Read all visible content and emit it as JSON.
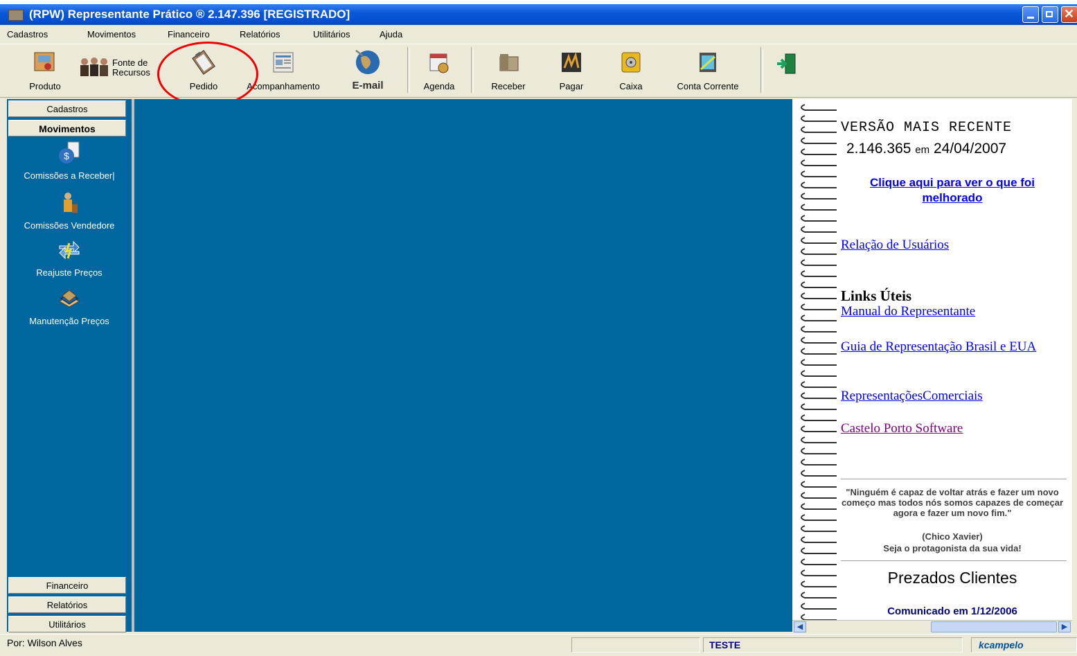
{
  "window": {
    "title": "(RPW) Representante Prático ® 2.147.396 [REGISTRADO]"
  },
  "menu": [
    "Cadastros",
    "Movimentos",
    "Financeiro",
    "Relatórios",
    "Utilitários",
    "Ajuda"
  ],
  "toolbar": {
    "produto": "Produto",
    "fonte_1": "Fonte de",
    "fonte_2": "Recursos",
    "pedido": "Pedido",
    "acompanhamento": "Acompanhamento",
    "email": "E-mail",
    "agenda": "Agenda",
    "receber": "Receber",
    "pagar": "Pagar",
    "caixa": "Caixa",
    "conta_corrente": "Conta Corrente"
  },
  "sidebar": {
    "cadastros": "Cadastros",
    "movimentos": "Movimentos",
    "items": [
      "Comissões a Receber|",
      "Comissões Vendedore",
      "Reajuste Preços",
      "Manutenção Preços"
    ],
    "financeiro": "Financeiro",
    "relatorios": "Relatórios",
    "utilitarios": "Utilitários"
  },
  "panel": {
    "versao_title": "VERSÃO MAIS RECENTE",
    "versao_num": "2.146.365",
    "versao_em": "em",
    "versao_date": "24/04/2007",
    "clique": "Clique aqui para ver o que foi melhorado",
    "relacao": "Relação de Usuários",
    "links_title": "Links Úteis",
    "manual": "Manual do Representante",
    "guia": "Guia de Representação Brasil e EUA",
    "representacoes": "RepresentaçõesComerciais",
    "castelo": "Castelo Porto Software",
    "quote": "\"Ninguém é capaz de voltar atrás e fazer um novo começo mas todos nós somos capazes de começar agora e fazer um novo fim.\"",
    "author": "(Chico Xavier)",
    "protagonista": "Seja o protagonista da sua vida!",
    "prezados": "Prezados Clientes",
    "comunicado": "Comunicado em 1/12/2006"
  },
  "status": {
    "por": "Por: Wilson Alves",
    "teste": "TESTE",
    "user": "kcampelo"
  },
  "colors": {
    "title_bar": "#0550d0",
    "desktop": "#00669e",
    "highlight_circle": "#e00000"
  }
}
